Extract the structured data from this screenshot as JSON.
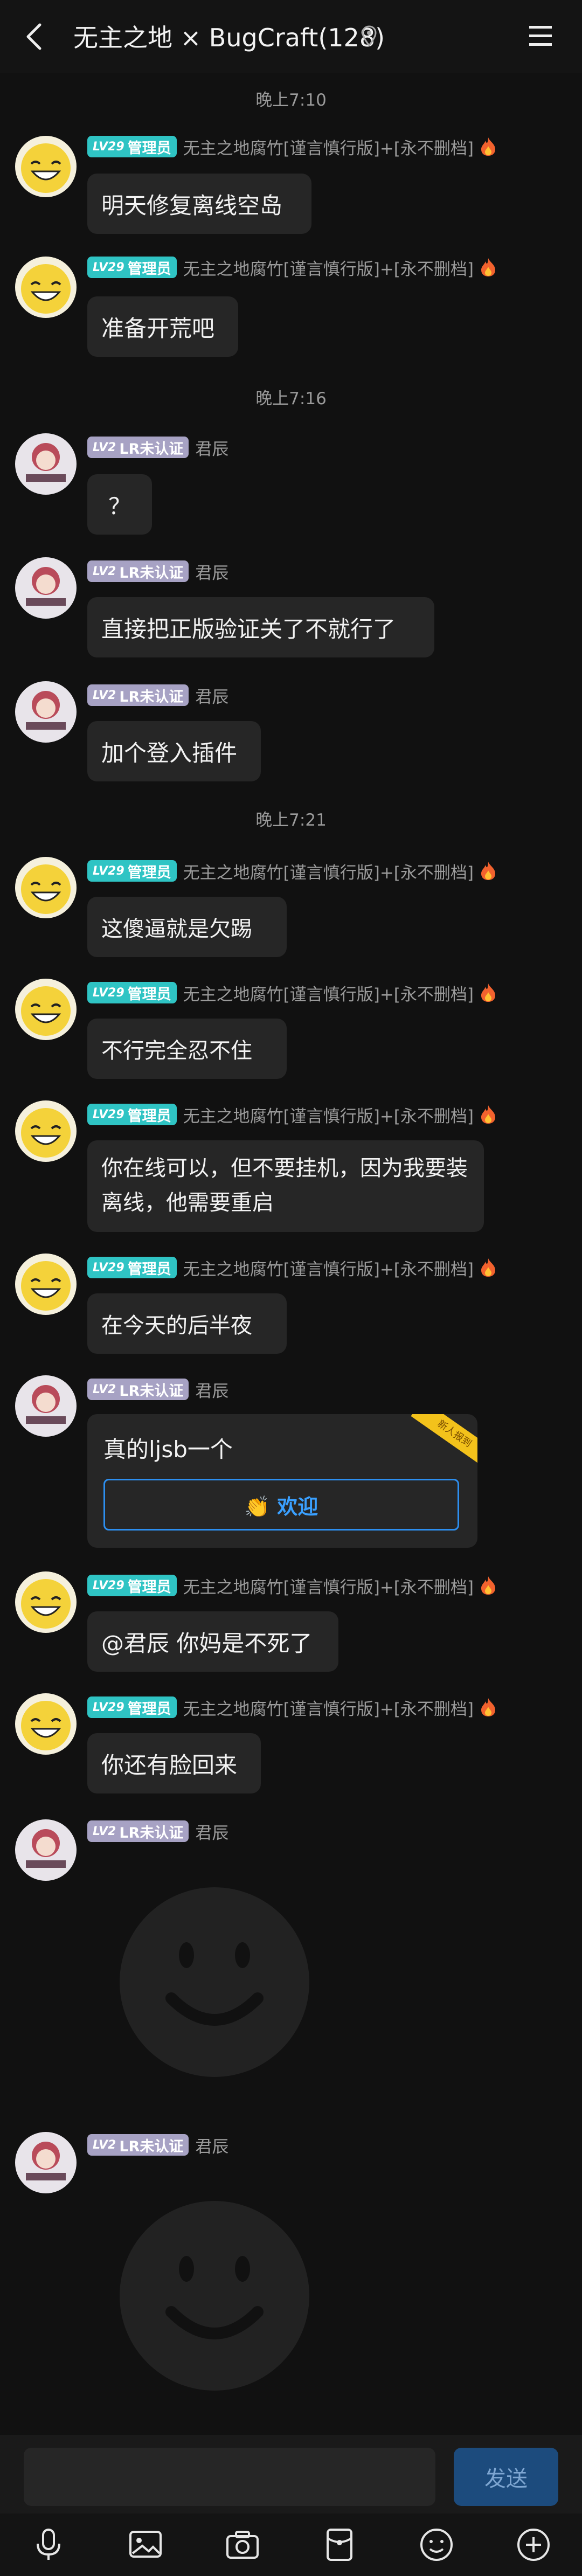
{
  "header": {
    "title": "无主之地 × BugCraft(128)"
  },
  "times": [
    "晚上7:10",
    "晚上7:16",
    "晚上7:21"
  ],
  "badges": {
    "admin_level": "LV29",
    "admin_role": "管理员",
    "lr_level": "LV2",
    "lr_role": "LR未认证"
  },
  "nicks": {
    "admin": "无主之地腐竹[谨言慎行版]+[永不删档]",
    "lr": "君辰"
  },
  "messages": {
    "m1": "明天修复离线空岛",
    "m2": "准备开荒吧",
    "m3": "？",
    "m4": "直接把正版验证关了不就行了",
    "m5": "加个登入插件",
    "m6": "这傻逼就是欠踢",
    "m7": "不行完全忍不住",
    "m8": "你在线可以，但不要挂机，因为我要装离线，他需要重启",
    "m9": "在今天的后半夜",
    "m10": "真的ljsb一个",
    "m10_button": "👏 欢迎",
    "m10_ribbon": "新人报到",
    "m11": "@君辰 你妈是不死了",
    "m12": "你还有脸回来"
  },
  "input": {
    "send_label": "发送"
  },
  "colors": {
    "admin_badge": "#2fc4c4",
    "lr_badge": "#a7a2c4",
    "send": "#1c4b7d",
    "link": "#2d8ff0"
  }
}
